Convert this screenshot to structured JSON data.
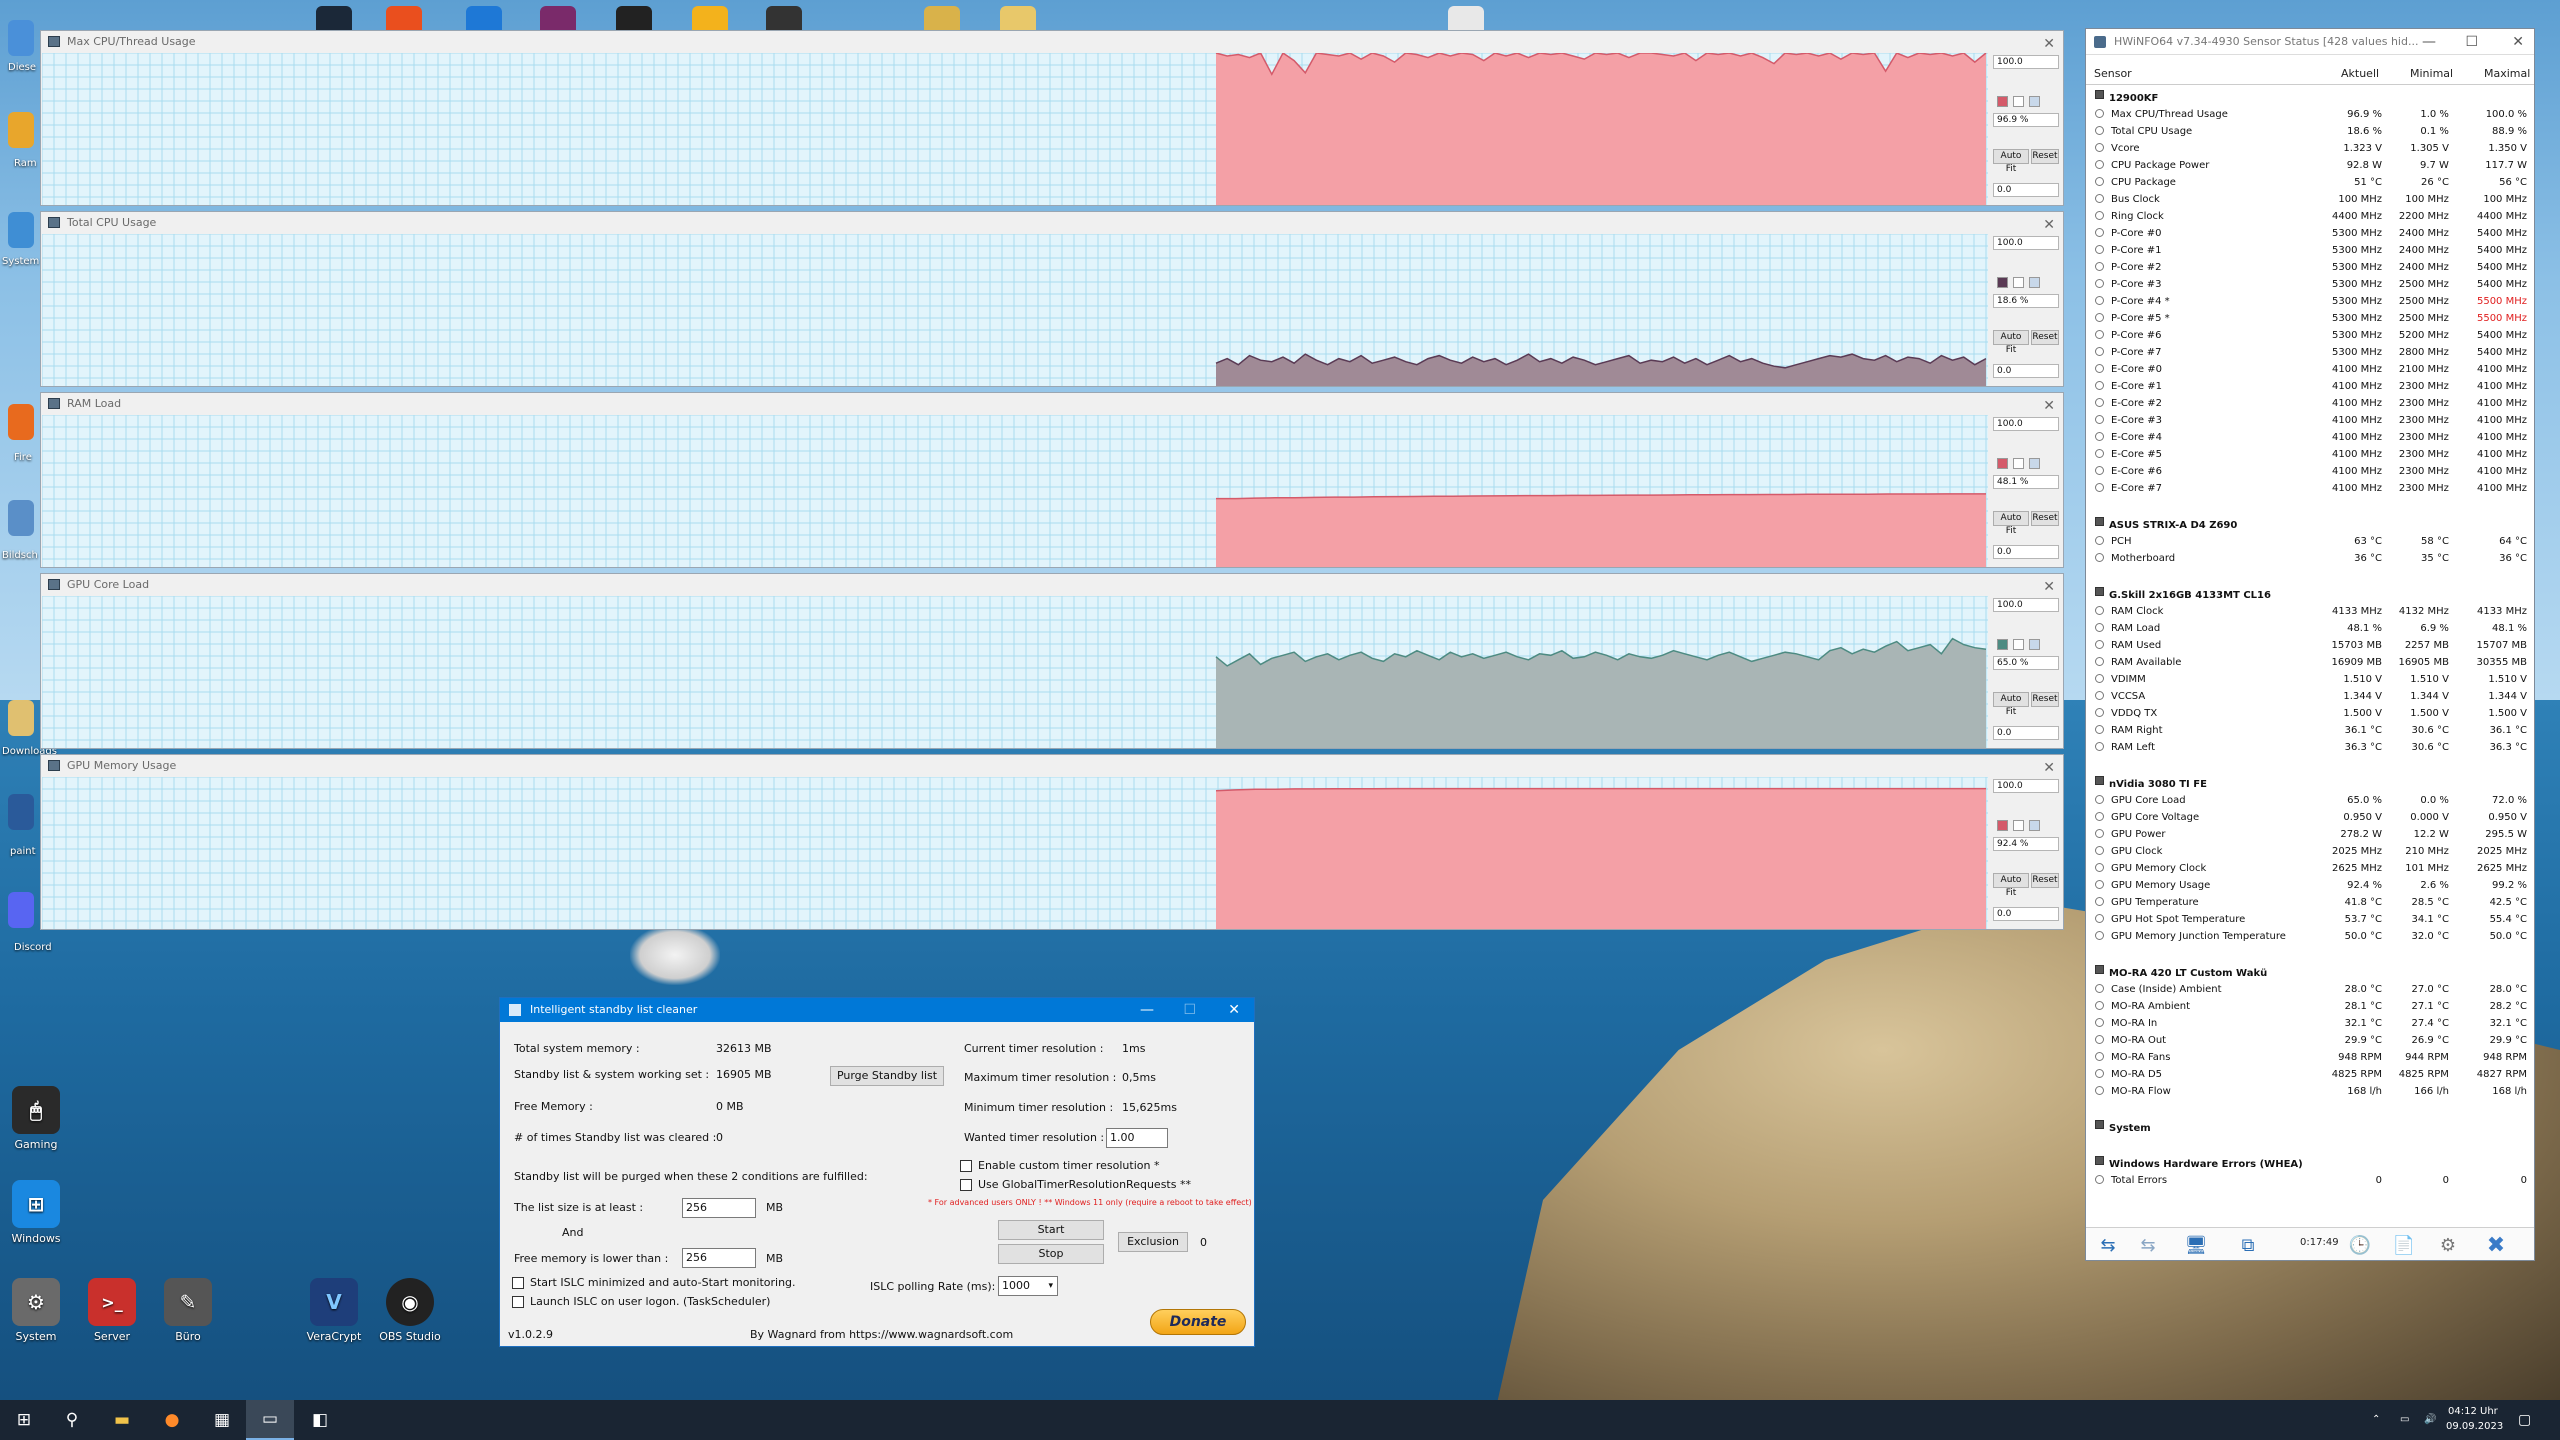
{
  "graphs": [
    {
      "title": "Max CPU/Thread Usage",
      "max": "100.0",
      "cur": "96.9 %",
      "min": "0.0",
      "color": "#f4a0a6",
      "line": "#d45a6a",
      "values": [
        100,
        98,
        99,
        97,
        100,
        86,
        100,
        95,
        87,
        100,
        99,
        98,
        100,
        96,
        100,
        98,
        94,
        100,
        99,
        97,
        100,
        98,
        100,
        99,
        95,
        100,
        98,
        100,
        97,
        100,
        99,
        100,
        98,
        96,
        100,
        99,
        100,
        97,
        100,
        100,
        99,
        98,
        100,
        95,
        100,
        99,
        100,
        98,
        100,
        97,
        93,
        100,
        99,
        100,
        98,
        100,
        96,
        100,
        99,
        100,
        88,
        100,
        97,
        100,
        99,
        100,
        98,
        100,
        94,
        100
      ]
    },
    {
      "title": "Total CPU Usage",
      "max": "100.0",
      "cur": "18.6 %",
      "min": "0.0",
      "color": "#a08a96",
      "line": "#5a3a54",
      "values": [
        15,
        18,
        14,
        20,
        17,
        16,
        19,
        15,
        21,
        17,
        14,
        18,
        16,
        20,
        15,
        17,
        19,
        16,
        14,
        18,
        20,
        17,
        15,
        19,
        16,
        18,
        14,
        17,
        21,
        16,
        18,
        15,
        19,
        17,
        14,
        16,
        18,
        20,
        15,
        17,
        16,
        19,
        15,
        18,
        14,
        17,
        20,
        16,
        18,
        15,
        13,
        12,
        14,
        16,
        18,
        20,
        19,
        21,
        18,
        17,
        20,
        16,
        19,
        18,
        15,
        20,
        17,
        19,
        14,
        18
      ]
    },
    {
      "title": "RAM Load",
      "max": "100.0",
      "cur": "48.1 %",
      "min": "0.0",
      "color": "#f4a0a6",
      "line": "#d45a6a",
      "values": [
        45,
        45,
        45.3,
        45.5,
        45.6,
        45.8,
        46,
        46,
        46.2,
        46.3,
        46.4,
        46.5,
        46.6,
        46.7,
        46.8,
        46.9,
        47,
        47,
        47.1,
        47.1,
        47.2,
        47.3,
        47.3,
        47.4,
        47.5,
        47.5,
        47.6,
        47.6,
        47.7,
        47.7,
        47.8,
        47.8,
        47.9,
        47.9,
        48,
        48,
        48,
        48.1,
        48.1,
        48.1
      ]
    },
    {
      "title": "GPU Core Load",
      "max": "100.0",
      "cur": "65.0 %",
      "min": "0.0",
      "color": "#a9b5b5",
      "line": "#4d8b82",
      "values": [
        60,
        54,
        58,
        62,
        55,
        59,
        61,
        63,
        57,
        60,
        62,
        58,
        61,
        63,
        59,
        57,
        62,
        60,
        64,
        61,
        58,
        63,
        60,
        62,
        59,
        61,
        63,
        60,
        58,
        62,
        61,
        64,
        59,
        60,
        63,
        61,
        58,
        62,
        60,
        59,
        61,
        64,
        62,
        60,
        58,
        61,
        63,
        60,
        57,
        59,
        61,
        63,
        62,
        60,
        58,
        64,
        66,
        62,
        65,
        63,
        67,
        70,
        64,
        66,
        68,
        62,
        72,
        68,
        66,
        65
      ]
    },
    {
      "title": "GPU Memory Usage",
      "max": "100.0",
      "cur": "92.4 %",
      "min": "0.0",
      "color": "#f4a0a6",
      "line": "#d45a6a",
      "values": [
        91,
        91.5,
        92,
        92,
        92.2,
        92.2,
        92.3,
        92.3,
        92.3,
        92.4,
        92.4,
        92.4,
        92.4,
        92.4,
        92.4,
        92.4,
        92.4,
        92.4,
        92.4,
        92.4,
        92.4,
        92.4,
        92.4,
        92.4,
        92.4,
        92.4,
        92.4,
        92.4,
        92.4,
        92.4,
        92.4,
        92.4,
        92.4,
        92.4,
        92.4,
        92.4,
        92.4,
        92.4,
        92.4,
        92.4
      ]
    }
  ],
  "graph_buttons": {
    "auto_fit": "Auto Fit",
    "reset": "Reset"
  },
  "hwinfo": {
    "title": "HWiNFO64 v7.34-4930 Sensor Status [428 values hid...",
    "cols": {
      "sensor": "Sensor",
      "current": "Aktuell",
      "min": "Minimal",
      "max": "Maximal"
    },
    "uptime": "0:17:49",
    "rows": [
      {
        "g": "12900KF"
      },
      {
        "n": "Max CPU/Thread Usage",
        "v": "96.9 %",
        "s": "1.0 %",
        "m": "100.0 %"
      },
      {
        "n": "Total CPU Usage",
        "v": "18.6 %",
        "s": "0.1 %",
        "m": "88.9 %"
      },
      {
        "n": "Vcore",
        "v": "1.323 V",
        "s": "1.305 V",
        "m": "1.350 V"
      },
      {
        "n": "CPU Package Power",
        "v": "92.8 W",
        "s": "9.7 W",
        "m": "117.7 W"
      },
      {
        "n": "CPU Package",
        "v": "51 °C",
        "s": "26 °C",
        "m": "56 °C"
      },
      {
        "n": "Bus Clock",
        "v": "100 MHz",
        "s": "100 MHz",
        "m": "100 MHz"
      },
      {
        "n": "Ring Clock",
        "v": "4400 MHz",
        "s": "2200 MHz",
        "m": "4400 MHz"
      },
      {
        "n": "P-Core #0",
        "v": "5300 MHz",
        "s": "2400 MHz",
        "m": "5400 MHz"
      },
      {
        "n": "P-Core #1",
        "v": "5300 MHz",
        "s": "2400 MHz",
        "m": "5400 MHz"
      },
      {
        "n": "P-Core #2",
        "v": "5300 MHz",
        "s": "2400 MHz",
        "m": "5400 MHz"
      },
      {
        "n": "P-Core #3",
        "v": "5300 MHz",
        "s": "2500 MHz",
        "m": "5400 MHz"
      },
      {
        "n": "P-Core #4 *",
        "v": "5300 MHz",
        "s": "2500 MHz",
        "m": "5500 MHz",
        "red": true
      },
      {
        "n": "P-Core #5 *",
        "v": "5300 MHz",
        "s": "2500 MHz",
        "m": "5500 MHz",
        "red": true
      },
      {
        "n": "P-Core #6",
        "v": "5300 MHz",
        "s": "5200 MHz",
        "m": "5400 MHz"
      },
      {
        "n": "P-Core #7",
        "v": "5300 MHz",
        "s": "2800 MHz",
        "m": "5400 MHz"
      },
      {
        "n": "E-Core #0",
        "v": "4100 MHz",
        "s": "2100 MHz",
        "m": "4100 MHz"
      },
      {
        "n": "E-Core #1",
        "v": "4100 MHz",
        "s": "2300 MHz",
        "m": "4100 MHz"
      },
      {
        "n": "E-Core #2",
        "v": "4100 MHz",
        "s": "2300 MHz",
        "m": "4100 MHz"
      },
      {
        "n": "E-Core #3",
        "v": "4100 MHz",
        "s": "2300 MHz",
        "m": "4100 MHz"
      },
      {
        "n": "E-Core #4",
        "v": "4100 MHz",
        "s": "2300 MHz",
        "m": "4100 MHz"
      },
      {
        "n": "E-Core #5",
        "v": "4100 MHz",
        "s": "2300 MHz",
        "m": "4100 MHz"
      },
      {
        "n": "E-Core #6",
        "v": "4100 MHz",
        "s": "2300 MHz",
        "m": "4100 MHz"
      },
      {
        "n": "E-Core #7",
        "v": "4100 MHz",
        "s": "2300 MHz",
        "m": "4100 MHz"
      },
      {
        "sp": true
      },
      {
        "g": "ASUS STRIX-A D4 Z690"
      },
      {
        "n": "PCH",
        "v": "63 °C",
        "s": "58 °C",
        "m": "64 °C"
      },
      {
        "n": "Motherboard",
        "v": "36 °C",
        "s": "35 °C",
        "m": "36 °C"
      },
      {
        "sp": true
      },
      {
        "g": "G.Skill 2x16GB 4133MT CL16"
      },
      {
        "n": "RAM Clock",
        "v": "4133 MHz",
        "s": "4132 MHz",
        "m": "4133 MHz"
      },
      {
        "n": "RAM Load",
        "v": "48.1 %",
        "s": "6.9 %",
        "m": "48.1 %"
      },
      {
        "n": "RAM Used",
        "v": "15703 MB",
        "s": "2257 MB",
        "m": "15707 MB"
      },
      {
        "n": "RAM Available",
        "v": "16909 MB",
        "s": "16905 MB",
        "m": "30355 MB"
      },
      {
        "n": "VDIMM",
        "v": "1.510 V",
        "s": "1.510 V",
        "m": "1.510 V"
      },
      {
        "n": "VCCSA",
        "v": "1.344 V",
        "s": "1.344 V",
        "m": "1.344 V"
      },
      {
        "n": "VDDQ TX",
        "v": "1.500 V",
        "s": "1.500 V",
        "m": "1.500 V"
      },
      {
        "n": "RAM Right",
        "v": "36.1 °C",
        "s": "30.6 °C",
        "m": "36.1 °C"
      },
      {
        "n": "RAM Left",
        "v": "36.3 °C",
        "s": "30.6 °C",
        "m": "36.3 °C"
      },
      {
        "sp": true
      },
      {
        "g": "nVidia 3080 TI FE"
      },
      {
        "n": "GPU Core Load",
        "v": "65.0 %",
        "s": "0.0 %",
        "m": "72.0 %"
      },
      {
        "n": "GPU Core Voltage",
        "v": "0.950 V",
        "s": "0.000 V",
        "m": "0.950 V"
      },
      {
        "n": "GPU Power",
        "v": "278.2 W",
        "s": "12.2 W",
        "m": "295.5 W"
      },
      {
        "n": "GPU Clock",
        "v": "2025 MHz",
        "s": "210 MHz",
        "m": "2025 MHz"
      },
      {
        "n": "GPU Memory Clock",
        "v": "2625 MHz",
        "s": "101 MHz",
        "m": "2625 MHz"
      },
      {
        "n": "GPU Memory Usage",
        "v": "92.4 %",
        "s": "2.6 %",
        "m": "99.2 %"
      },
      {
        "n": "GPU Temperature",
        "v": "41.8 °C",
        "s": "28.5 °C",
        "m": "42.5 °C"
      },
      {
        "n": "GPU Hot Spot Temperature",
        "v": "53.7 °C",
        "s": "34.1 °C",
        "m": "55.4 °C"
      },
      {
        "n": "GPU Memory Junction Temperature",
        "v": "50.0 °C",
        "s": "32.0 °C",
        "m": "50.0 °C"
      },
      {
        "sp": true
      },
      {
        "g": "MO-RA 420 LT Custom Wakü"
      },
      {
        "n": "Case (Inside) Ambient",
        "v": "28.0 °C",
        "s": "27.0 °C",
        "m": "28.0 °C"
      },
      {
        "n": "MO-RA Ambient",
        "v": "28.1 °C",
        "s": "27.1 °C",
        "m": "28.2 °C"
      },
      {
        "n": "MO-RA In",
        "v": "32.1 °C",
        "s": "27.4 °C",
        "m": "32.1 °C"
      },
      {
        "n": "MO-RA Out",
        "v": "29.9 °C",
        "s": "26.9 °C",
        "m": "29.9 °C"
      },
      {
        "n": "MO-RA Fans",
        "v": "948 RPM",
        "s": "944 RPM",
        "m": "948 RPM"
      },
      {
        "n": "MO-RA D5",
        "v": "4825 RPM",
        "s": "4825 RPM",
        "m": "4827 RPM"
      },
      {
        "n": "MO-RA Flow",
        "v": "168 l/h",
        "s": "166 l/h",
        "m": "168 l/h"
      },
      {
        "sp": true
      },
      {
        "g": "System"
      },
      {
        "sp": true
      },
      {
        "g": "Windows Hardware Errors (WHEA)"
      },
      {
        "n": "Total Errors",
        "v": "0",
        "s": "0",
        "m": "0"
      }
    ]
  },
  "islc": {
    "title": "Intelligent standby list cleaner",
    "total_mem_label": "Total system memory :",
    "total_mem": "32613 MB",
    "standby_label": "Standby list & system working set :",
    "standby": "16905 MB",
    "purge_btn": "Purge Standby list",
    "free_label": "Free Memory :",
    "free": "0 MB",
    "cleared_label": "# of times Standby list was cleared :",
    "cleared": "0",
    "conditions": "Standby list will be purged when these 2 conditions are fulfilled:",
    "list_size_label": "The list size is at least :",
    "list_size": "256",
    "mb1": "MB",
    "and": "And",
    "free_lower_label": "Free memory is lower than :",
    "free_lower": "256",
    "mb2": "MB",
    "cur_timer_label": "Current timer resolution :",
    "cur_timer": "1ms",
    "max_timer_label": "Maximum timer resolution :",
    "max_timer": "0,5ms",
    "min_timer_label": "Minimum timer resolution :",
    "min_timer": "15,625ms",
    "wanted_label": "Wanted timer resolution :",
    "wanted": "1.00",
    "enable_custom": "Enable custom timer resolution *",
    "use_global": "Use GlobalTimerResolutionRequests **",
    "warning": "* For advanced users ONLY !  ** Windows 11 only (require a reboot to take effect)",
    "start_btn": "Start",
    "stop_btn": "Stop",
    "exclusion_btn": "Exclusion",
    "exclusion_count": "0",
    "start_min": "Start ISLC minimized and auto-Start monitoring.",
    "launch_logon": "Launch ISLC on user logon. (TaskScheduler)",
    "polling_label": "ISLC polling Rate (ms):",
    "polling": "1000",
    "version": "v1.0.2.9",
    "by": "By Wagnard from https://www.wagnardsoft.com",
    "donate": "Donate"
  },
  "desktop_icons": [
    {
      "label": "Gaming",
      "color": "#2a2a2a",
      "glyph": "🖱"
    },
    {
      "label": "Windows",
      "color": "#1a88e0",
      "glyph": "⊞"
    },
    {
      "label": "System",
      "color": "#6a6a6a",
      "glyph": "⚙"
    },
    {
      "label": "Server",
      "color": "#c9302c",
      "glyph": ">_"
    },
    {
      "label": "Büro",
      "color": "#555",
      "glyph": "✎"
    },
    {
      "label": "VeraCrypt",
      "color": "#1e3e7a",
      "glyph": "V"
    },
    {
      "label": "OBS Studio",
      "color": "#222",
      "glyph": "◉"
    }
  ],
  "edge_labels": [
    "Diese",
    "Ram",
    "System",
    "Fire",
    "Bildsch",
    "Downloads",
    "paint",
    "Discord"
  ],
  "taskbar": {
    "time": "04:12 Uhr",
    "date": "09.09.2023"
  }
}
